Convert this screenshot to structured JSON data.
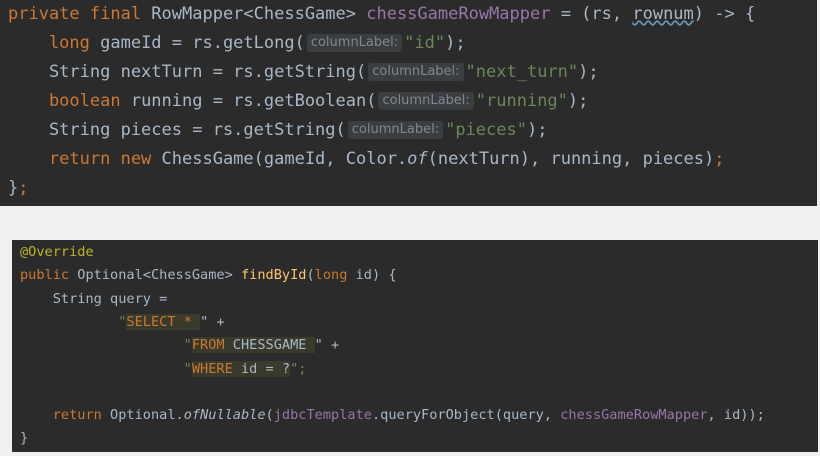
{
  "top_snippet": {
    "lines": [
      [
        {
          "t": "private final ",
          "c": "kw"
        },
        {
          "t": "RowMapper<ChessGame> ",
          "c": "tx"
        },
        {
          "t": "chessGameRowMapper",
          "c": "fld"
        },
        {
          "t": " = (rs, ",
          "c": "tx"
        },
        {
          "t": "rownum",
          "c": "tx wavy"
        },
        {
          "t": ") -> {",
          "c": "tx"
        }
      ],
      [
        {
          "t": "    long ",
          "c": "kw"
        },
        {
          "t": "gameId = rs.getLong(",
          "c": "tx"
        },
        {
          "t": "columnLabel:",
          "c": "hint"
        },
        {
          "t": "\"id\"",
          "c": "str"
        },
        {
          "t": ");",
          "c": "tx"
        }
      ],
      [
        {
          "t": "    String nextTurn = rs.getString(",
          "c": "tx"
        },
        {
          "t": "columnLabel:",
          "c": "hint"
        },
        {
          "t": "\"next_turn\"",
          "c": "str"
        },
        {
          "t": ");",
          "c": "tx"
        }
      ],
      [
        {
          "t": "    boolean ",
          "c": "kw"
        },
        {
          "t": "running = rs.getBoolean(",
          "c": "tx"
        },
        {
          "t": "columnLabel:",
          "c": "hint"
        },
        {
          "t": "\"running\"",
          "c": "str"
        },
        {
          "t": ");",
          "c": "tx"
        }
      ],
      [
        {
          "t": "    String pieces = rs.getString(",
          "c": "tx"
        },
        {
          "t": "columnLabel:",
          "c": "hint"
        },
        {
          "t": "\"pieces\"",
          "c": "str"
        },
        {
          "t": ");",
          "c": "tx"
        }
      ],
      [
        {
          "t": "    return new ",
          "c": "kw"
        },
        {
          "t": "ChessGame(gameId, Color.",
          "c": "tx"
        },
        {
          "t": "of",
          "c": "tx it"
        },
        {
          "t": "(nextTurn), running, pieces)",
          "c": "tx"
        },
        {
          "t": ";",
          "c": "kw"
        }
      ],
      [
        {
          "t": "}",
          "c": "tx"
        },
        {
          "t": ";",
          "c": "kw"
        }
      ]
    ]
  },
  "bottom_snippet": {
    "lines": [
      [
        {
          "t": "@Override",
          "c": "ann"
        }
      ],
      [
        {
          "t": "public ",
          "c": "kw"
        },
        {
          "t": "Optional<ChessGame> ",
          "c": "tx"
        },
        {
          "t": "findById",
          "c": "fn"
        },
        {
          "t": "(",
          "c": "tx"
        },
        {
          "t": "long ",
          "c": "kw"
        },
        {
          "t": "id) {",
          "c": "tx"
        }
      ],
      [
        {
          "t": "    String query =",
          "c": "tx"
        }
      ],
      [
        {
          "t": "            \"",
          "c": "str"
        },
        {
          "t": "SELECT * ",
          "c": "kw sql"
        },
        {
          "t": "\" +",
          "c": "tx"
        }
      ],
      [
        {
          "t": "                    \"",
          "c": "str"
        },
        {
          "t": "FROM ",
          "c": "kw sql"
        },
        {
          "t": "CHESSGAME ",
          "c": "tx sql"
        },
        {
          "t": "\" +",
          "c": "tx"
        }
      ],
      [
        {
          "t": "                    \"",
          "c": "str"
        },
        {
          "t": "WHERE ",
          "c": "kw sql"
        },
        {
          "t": "id = ?",
          "c": "tx sql"
        },
        {
          "t": "\";",
          "c": "str"
        }
      ],
      [],
      [
        {
          "t": "    return ",
          "c": "kw"
        },
        {
          "t": "Optional.",
          "c": "tx"
        },
        {
          "t": "ofNullable",
          "c": "tx it"
        },
        {
          "t": "(",
          "c": "tx"
        },
        {
          "t": "jdbcTemplate",
          "c": "fld"
        },
        {
          "t": ".queryForObject(query, ",
          "c": "tx"
        },
        {
          "t": "chessGameRowMapper",
          "c": "fld"
        },
        {
          "t": ", id));",
          "c": "tx"
        }
      ],
      [
        {
          "t": "}",
          "c": "tx"
        }
      ]
    ]
  }
}
